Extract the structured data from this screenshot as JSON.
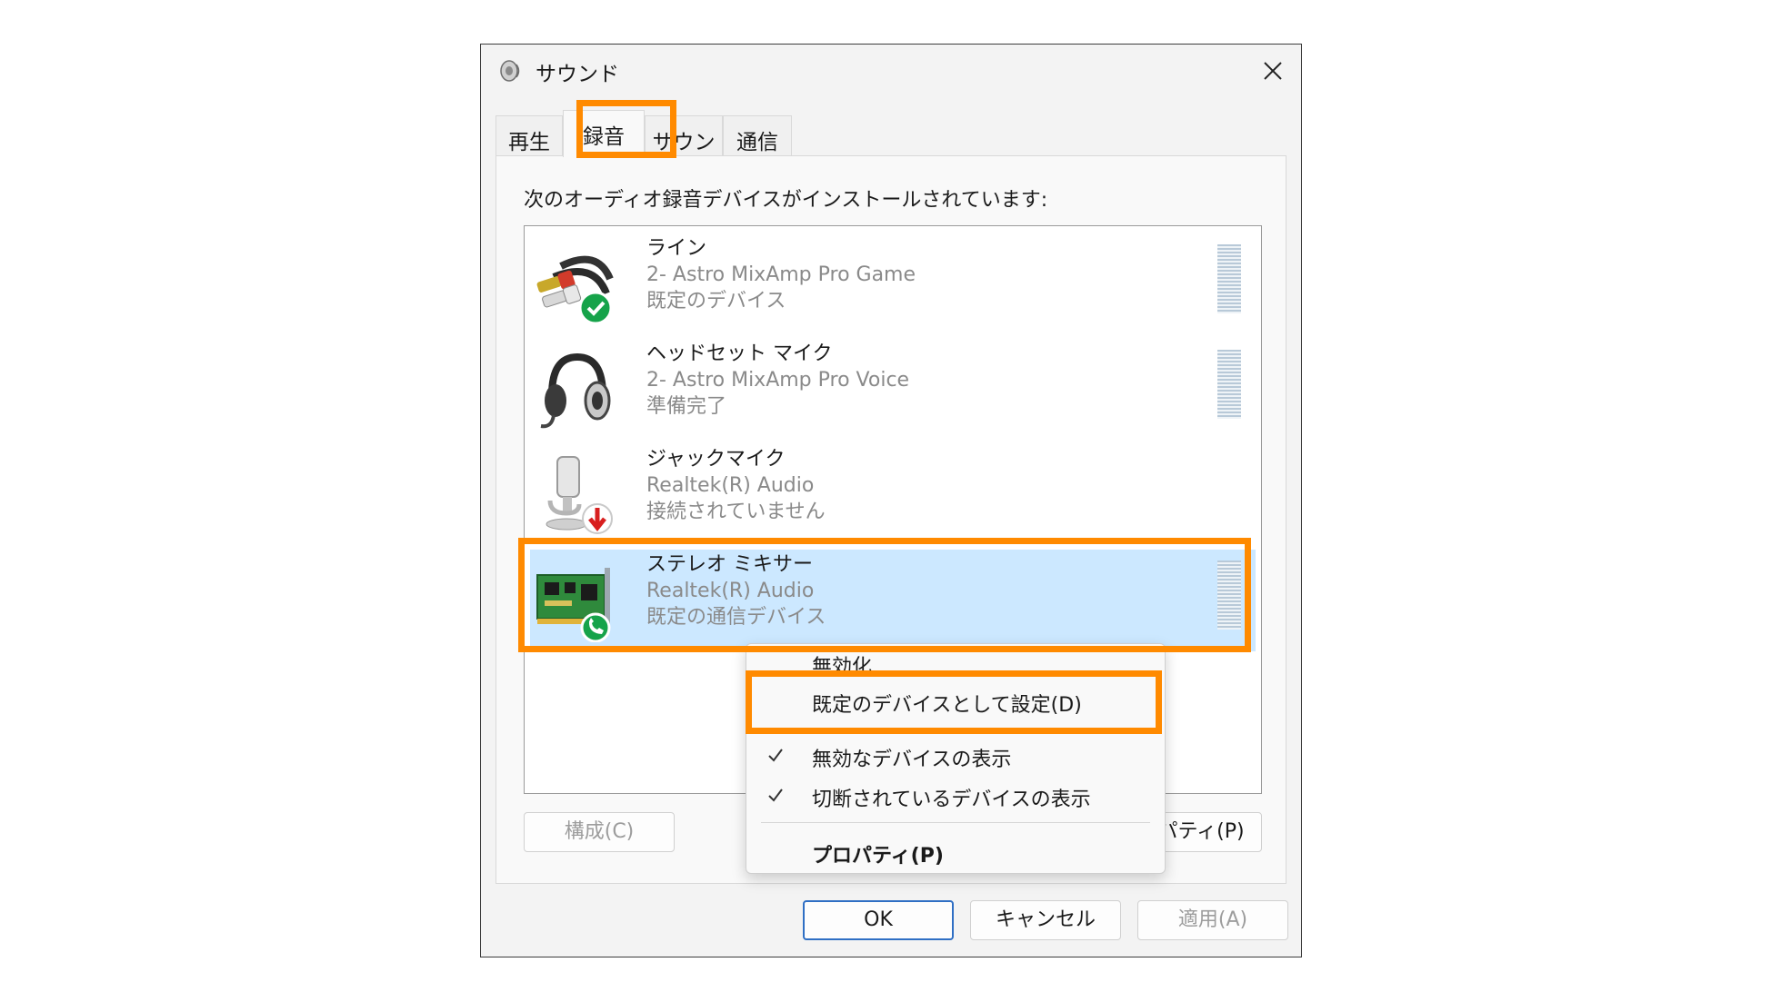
{
  "window": {
    "title": "サウンド"
  },
  "tabs": [
    {
      "label": "再生"
    },
    {
      "label": "録音",
      "active": true
    },
    {
      "label": "サウンド"
    },
    {
      "label": "通信"
    }
  ],
  "instruction": "次のオーディオ録音デバイスがインストールされています:",
  "devices": [
    {
      "name": "ライン",
      "driver": "2- Astro MixAmp Pro Game",
      "status": "既定のデバイス",
      "icon": "rca-cable-icon",
      "badge": "default-check-badge"
    },
    {
      "name": "ヘッドセット マイク",
      "driver": "2- Astro MixAmp Pro Voice",
      "status": "準備完了",
      "icon": "headset-icon"
    },
    {
      "name": "ジャックマイク",
      "driver": "Realtek(R) Audio",
      "status": "接続されていません",
      "icon": "microphone-icon",
      "badge": "disconnected-arrow-badge"
    },
    {
      "name": "ステレオ ミキサー",
      "driver": "Realtek(R) Audio",
      "status": "既定の通信デバイス",
      "icon": "sound-card-icon",
      "badge": "phone-badge",
      "selected": true
    }
  ],
  "buttons": {
    "configure": "構成(C)",
    "properties": "プロパティ(P)",
    "ok": "OK",
    "cancel": "キャンセル",
    "apply": "適用(A)"
  },
  "context_menu": {
    "items": [
      {
        "label": "無効化"
      },
      {
        "label": "既定のデバイスとして設定(D)"
      },
      {
        "label": "無効なデバイスの表示",
        "checked": true
      },
      {
        "label": "切断されているデバイスの表示",
        "checked": true
      },
      {
        "label": "プロパティ(P)",
        "bold": true
      }
    ]
  },
  "colors": {
    "highlight": "#ff8a00",
    "selection": "#cce8ff",
    "ok_border": "#2f6fc4"
  }
}
